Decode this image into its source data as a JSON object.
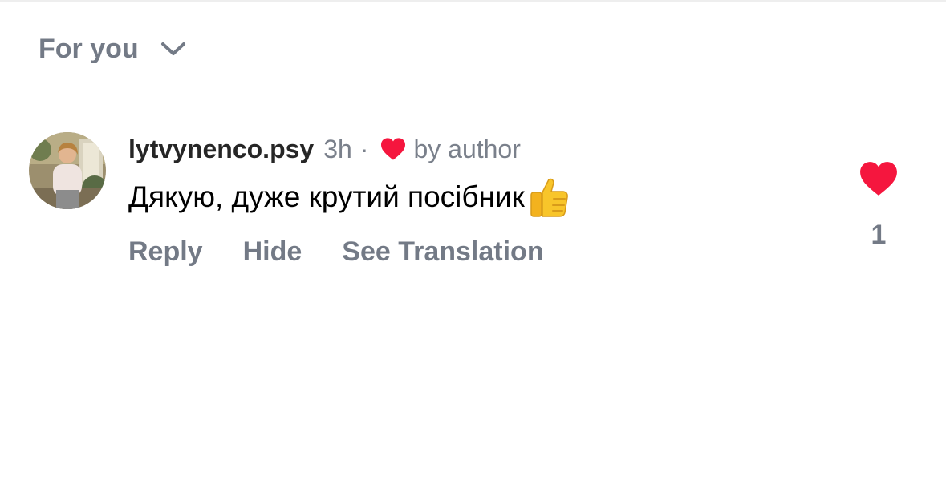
{
  "sort": {
    "label": "For you",
    "icon": "chevron-down-icon"
  },
  "comment": {
    "username": "lytvynenco.psy",
    "time": "3h",
    "separator": "·",
    "author_like_label": "by author",
    "text": "Дякую, дуже крутий посібник",
    "emoji": "thumbs-up-emoji",
    "actions": {
      "reply": "Reply",
      "hide": "Hide",
      "translate": "See Translation"
    },
    "like_count": "1",
    "liked": true
  },
  "colors": {
    "heart": "#f5163e",
    "muted_text": "#737a86",
    "username": "#262626",
    "body_text": "#000000"
  }
}
